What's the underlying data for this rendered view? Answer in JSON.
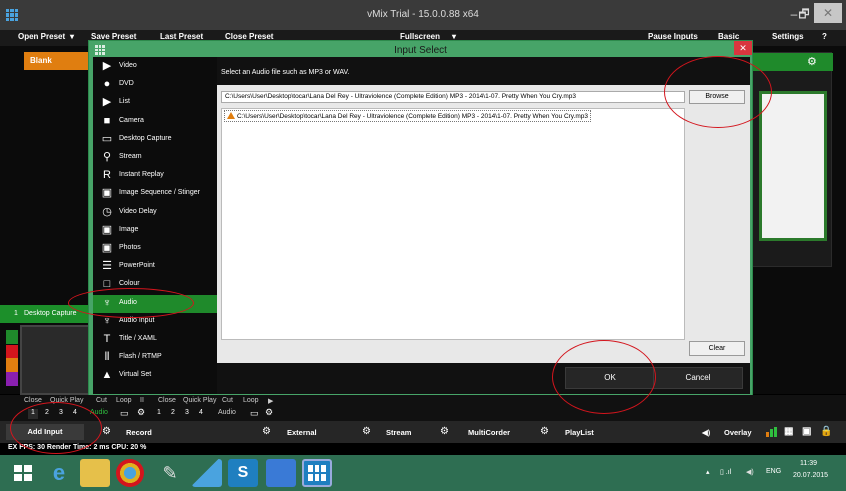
{
  "window": {
    "title": "vMix Trial - 15.0.0.88 x64",
    "minimize": "–",
    "maximize": "🗗",
    "close": "✕"
  },
  "toolbar": {
    "open_preset": "Open Preset",
    "open_preset_arrow": "▾",
    "save_preset": "Save Preset",
    "last_preset": "Last Preset",
    "close_preset": "Close Preset",
    "fullscreen": "Fullscreen",
    "fullscreen_arrow": "▾",
    "pause_inputs": "Pause Inputs",
    "basic": "Basic",
    "settings": "Settings",
    "help": "?"
  },
  "preview": {
    "blank_label": "Blank"
  },
  "left_panel": {
    "input_number": "1",
    "input_name": "Desktop Capture"
  },
  "dialog": {
    "title": "Input Select",
    "close": "✕",
    "input_types": [
      {
        "label": "Video",
        "icon": "video-icon"
      },
      {
        "label": "DVD",
        "icon": "dvd-icon"
      },
      {
        "label": "List",
        "icon": "list-icon"
      },
      {
        "label": "Camera",
        "icon": "camera-icon"
      },
      {
        "label": "Desktop Capture",
        "icon": "monitor-icon"
      },
      {
        "label": "Stream",
        "icon": "antenna-icon"
      },
      {
        "label": "Instant Replay",
        "icon": "replay-icon"
      },
      {
        "label": "Image Sequence / Stinger",
        "icon": "image-sequence-icon"
      },
      {
        "label": "Video Delay",
        "icon": "clock-icon"
      },
      {
        "label": "Image",
        "icon": "image-icon"
      },
      {
        "label": "Photos",
        "icon": "photos-icon"
      },
      {
        "label": "PowerPoint",
        "icon": "powerpoint-icon"
      },
      {
        "label": "Colour",
        "icon": "colour-icon"
      },
      {
        "label": "Audio",
        "icon": "microphone-icon",
        "selected": true
      },
      {
        "label": "Audio Input",
        "icon": "microphone-icon"
      },
      {
        "label": "Title / XAML",
        "icon": "title-icon"
      },
      {
        "label": "Flash / RTMP",
        "icon": "flash-icon"
      },
      {
        "label": "Virtual Set",
        "icon": "virtual-set-icon"
      }
    ],
    "instruction": "Select an Audio file such as MP3 or WAV.",
    "file_path": "C:\\Users\\User\\Desktop\\tocar\\Lana Del Rey - Ultraviolence (Complete Edition) MP3 - 2014\\1-07. Pretty When You Cry.mp3",
    "browse_label": "Browse",
    "file_list": [
      "C:\\Users\\User\\Desktop\\tocar\\Lana Del Rey - Ultraviolence (Complete Edition) MP3 - 2014\\1-07. Pretty When You Cry.mp3"
    ],
    "clear_label": "Clear",
    "ok_label": "OK",
    "cancel_label": "Cancel"
  },
  "transport": {
    "labels_row1": [
      "Close",
      "Quick Play",
      "Cut",
      "Loop",
      "II",
      "Close",
      "Quick Play",
      "Cut",
      "Loop",
      "▶"
    ],
    "numbers_left": [
      "1",
      "2",
      "3",
      "4"
    ],
    "audio_left": "Audio",
    "numbers_right": [
      "1",
      "2",
      "3",
      "4"
    ],
    "audio_right": "Audio"
  },
  "bottombar": {
    "add_input": "Add Input",
    "record": "Record",
    "external": "External",
    "stream": "Stream",
    "multicorder": "MultiCorder",
    "playlist": "PlayList",
    "overlay": "Overlay"
  },
  "status": "EX FPS: 30  Render Time: 2 ms  CPU: 20 %",
  "taskbar": {
    "lang": "ENG",
    "time": "11:39",
    "date": "20.07.2015"
  },
  "colors": {
    "accent_green": "#1f8a2b",
    "dialog_green": "#47a468",
    "orange": "#e07e10",
    "annotation_red": "#d3151d"
  }
}
